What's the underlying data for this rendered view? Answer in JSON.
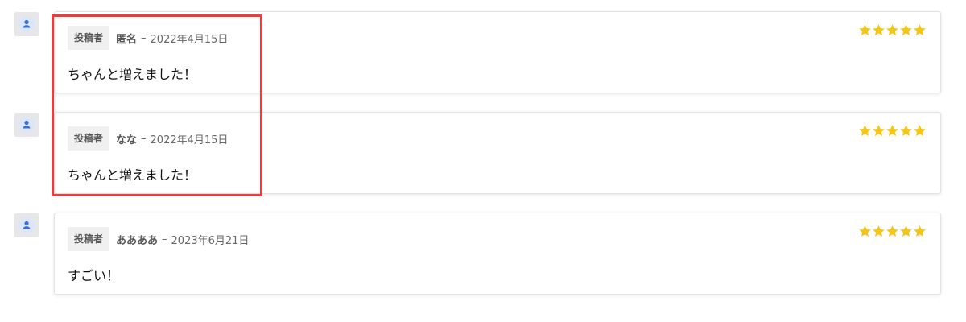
{
  "reviews": [
    {
      "badge": "投稿者",
      "author": "匿名",
      "separator": "–",
      "date": "2022年4月15日",
      "text": "ちゃんと増えました！",
      "rating": 5,
      "avatar_icon": "user-avatar-icon"
    },
    {
      "badge": "投稿者",
      "author": "なな",
      "separator": "–",
      "date": "2022年4月15日",
      "text": "ちゃんと増えました！",
      "rating": 5,
      "avatar_icon": "user-avatar-icon"
    },
    {
      "badge": "投稿者",
      "author": "ああああ",
      "separator": "–",
      "date": "2023年6月21日",
      "text": "すごい！",
      "rating": 5,
      "avatar_icon": "user-avatar-icon"
    }
  ],
  "colors": {
    "star": "#f5c518",
    "highlight_border": "#ee3b3b",
    "avatar_accent": "#3b6fd8"
  }
}
